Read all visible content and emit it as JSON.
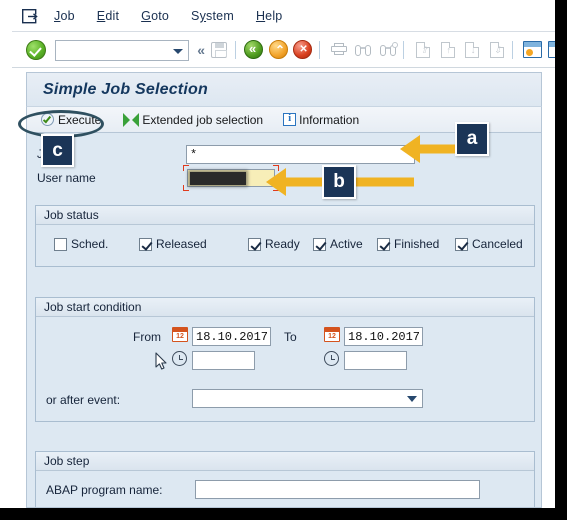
{
  "window": {
    "title": "Simple Job Selection"
  },
  "menubar": {
    "system_icon": "sap-session-icon",
    "items": [
      {
        "label": "Job",
        "accel": "J"
      },
      {
        "label": "Edit",
        "accel": "E"
      },
      {
        "label": "Goto",
        "accel": "G"
      },
      {
        "label": "System",
        "accel": "y"
      },
      {
        "label": "Help",
        "accel": "H"
      }
    ]
  },
  "toolbar": {
    "enter_icon": "green-check-enter-icon",
    "command_field_value": "",
    "command_field_placeholder": "",
    "dropdown_icon": "chevron-down-icon",
    "collapse_icon": "double-chevron-left-icon",
    "buttons": [
      {
        "name": "save-icon",
        "label": "Save"
      },
      {
        "name": "back-icon",
        "label": "Back"
      },
      {
        "name": "exit-icon",
        "label": "Exit"
      },
      {
        "name": "cancel-icon",
        "label": "Cancel"
      },
      {
        "name": "print-icon",
        "label": "Print"
      },
      {
        "name": "find-icon",
        "label": "Find"
      },
      {
        "name": "find-next-icon",
        "label": "Find Next"
      },
      {
        "name": "first-page-icon",
        "label": "First Page"
      },
      {
        "name": "previous-page-icon",
        "label": "Previous Page"
      },
      {
        "name": "next-page-icon",
        "label": "Next Page"
      },
      {
        "name": "last-page-icon",
        "label": "Last Page"
      },
      {
        "name": "create-session-icon",
        "label": "Create New Session"
      },
      {
        "name": "create-shortcut-icon",
        "label": "Create Shortcut"
      }
    ]
  },
  "app_toolbar": {
    "execute": {
      "label": "Execute",
      "icon": "execute-clock-check-icon"
    },
    "extended": {
      "label": "Extended job selection",
      "icon": "extended-selection-icon"
    },
    "information": {
      "label": "Information",
      "icon": "info-icon"
    }
  },
  "form": {
    "job": {
      "label": "Job",
      "value": "*"
    },
    "user_name": {
      "label": "User name",
      "value": "",
      "redacted": true
    }
  },
  "job_status": {
    "title": "Job status",
    "options": [
      {
        "label": "Sched.",
        "checked": false
      },
      {
        "label": "Released",
        "checked": true
      },
      {
        "label": "Ready",
        "checked": true
      },
      {
        "label": "Active",
        "checked": true
      },
      {
        "label": "Finished",
        "checked": true
      },
      {
        "label": "Canceled",
        "checked": true
      }
    ]
  },
  "job_start_condition": {
    "title": "Job start condition",
    "from_label": "From",
    "from_date": "18.10.2017",
    "from_time": "",
    "to_label": "To",
    "to_date": "18.10.2017",
    "to_time": "",
    "event_label": "or after event:",
    "event_value": "",
    "calendar_icon": "calendar-12-icon",
    "clock_icon": "clock-icon",
    "dropdown_icon": "chevron-down-icon"
  },
  "job_step": {
    "title": "Job step",
    "abap_label": "ABAP program name:",
    "abap_value": ""
  },
  "annotations": {
    "markers": [
      {
        "id": "a",
        "label": "a",
        "target": "job-input"
      },
      {
        "id": "b",
        "label": "b",
        "target": "user-name-input"
      },
      {
        "id": "c",
        "label": "c",
        "target": "execute-button"
      }
    ],
    "marker_bg": "#1b3557",
    "arrow_color": "#f0b323",
    "ellipse_color": "#2f5060"
  }
}
